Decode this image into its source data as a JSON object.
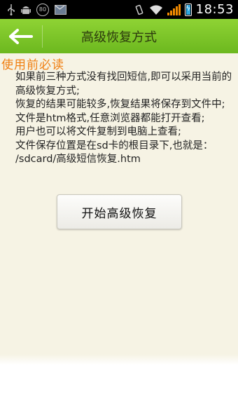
{
  "status_bar": {
    "time": "18:53",
    "icons": [
      "usb-icon",
      "android-debug-icon",
      "circle-80-icon",
      "mail-icon",
      "vibrate-icon",
      "wifi-icon",
      "signal-icon",
      "battery-charging-icon"
    ],
    "circle_label": "80"
  },
  "header": {
    "title": "高级恢复方式",
    "back_icon": "back-arrow-icon"
  },
  "notice": {
    "heading": "使用前必读",
    "lines": [
      "如果前三种方式没有找回短信,即可以采用当前的高级恢复方式;",
      "恢复的结果可能较多,恢复结果将保存到文件中;",
      "文件是htm格式,任意浏览器都能打开查看;",
      "用户也可以将文件复制到电脑上查看;",
      "文件保存位置是在sd卡的根目录下,也就是：",
      "/sdcard/高级短信恢复.htm"
    ]
  },
  "actions": {
    "start_label": "开始高级恢复"
  },
  "colors": {
    "header_green": "#7cc42a",
    "accent_orange": "#f07f12",
    "background": "#f6f3e4"
  }
}
